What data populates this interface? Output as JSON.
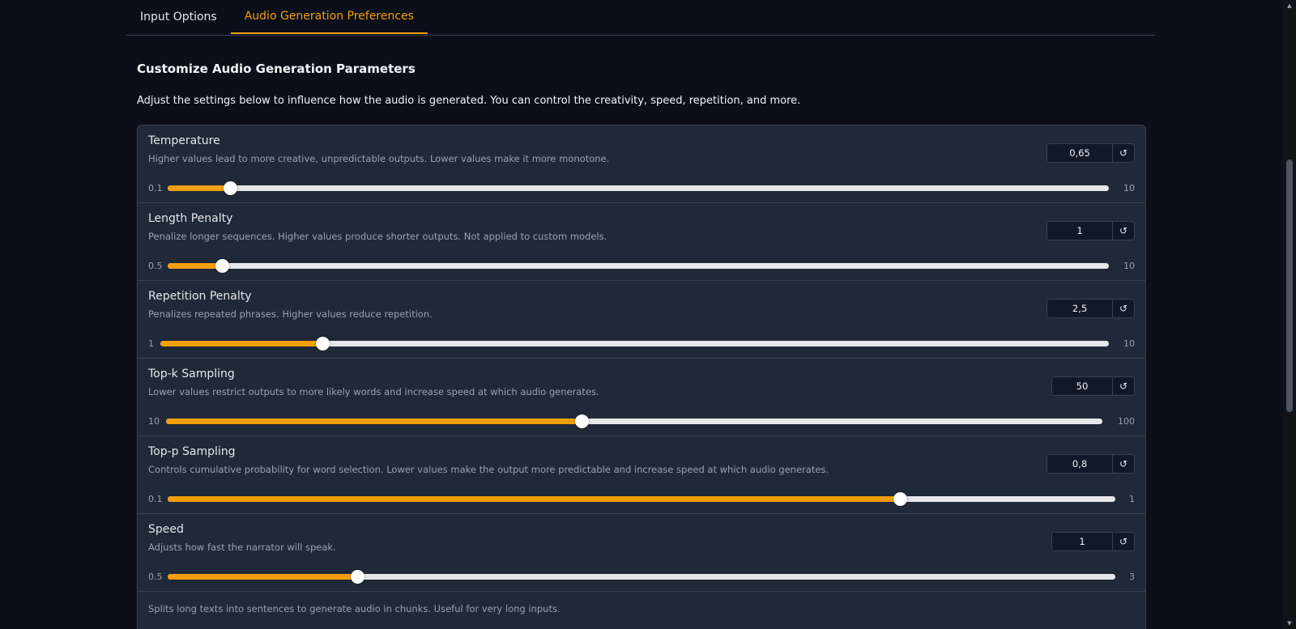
{
  "tabs": [
    {
      "label": "Input Options",
      "active": false
    },
    {
      "label": "Audio Generation Preferences",
      "active": true
    }
  ],
  "section": {
    "title": "Customize Audio Generation Parameters",
    "description": "Adjust the settings below to influence how the audio is generated. You can control the creativity, speed, repetition, and more."
  },
  "params": [
    {
      "label": "Temperature",
      "info": "Higher values lead to more creative, unpredictable outputs. Lower values make it more monotone.",
      "value": "0,65",
      "min": "0.1",
      "max": "10",
      "fill_fraction": 0.066
    },
    {
      "label": "Length Penalty",
      "info": "Penalize longer sequences. Higher values produce shorter outputs. Not applied to custom models.",
      "value": "1",
      "min": "0.5",
      "max": "10",
      "fill_fraction": 0.058
    },
    {
      "label": "Repetition Penalty",
      "info": "Penalizes repeated phrases. Higher values reduce repetition.",
      "value": "2,5",
      "min": "1",
      "max": "10",
      "fill_fraction": 0.171
    },
    {
      "label": "Top-k Sampling",
      "info": "Lower values restrict outputs to more likely words and increase speed at which audio generates.",
      "value": "50",
      "min": "10",
      "max": "100",
      "fill_fraction": 0.444
    },
    {
      "label": "Top-p Sampling",
      "info": "Controls cumulative probability for word selection. Lower values make the output more predictable and increase speed at which audio generates.",
      "value": "0,8",
      "min": "0.1",
      "max": "1",
      "fill_fraction": 0.773
    },
    {
      "label": "Speed",
      "info": "Adjusts how fast the narrator will speak.",
      "value": "1",
      "min": "0.5",
      "max": "3",
      "fill_fraction": 0.2
    }
  ],
  "footnote": "Splits long texts into sentences to generate audio in chunks. Useful for very long inputs.",
  "icons": {
    "reset": "reset-icon",
    "scroll_up": "chevron-up-icon",
    "scroll_down": "chevron-down-icon"
  },
  "colors": {
    "accent": "#f59e0b",
    "background": "#0b0f19",
    "panel": "#1f2937",
    "track": "#e5e7eb"
  }
}
